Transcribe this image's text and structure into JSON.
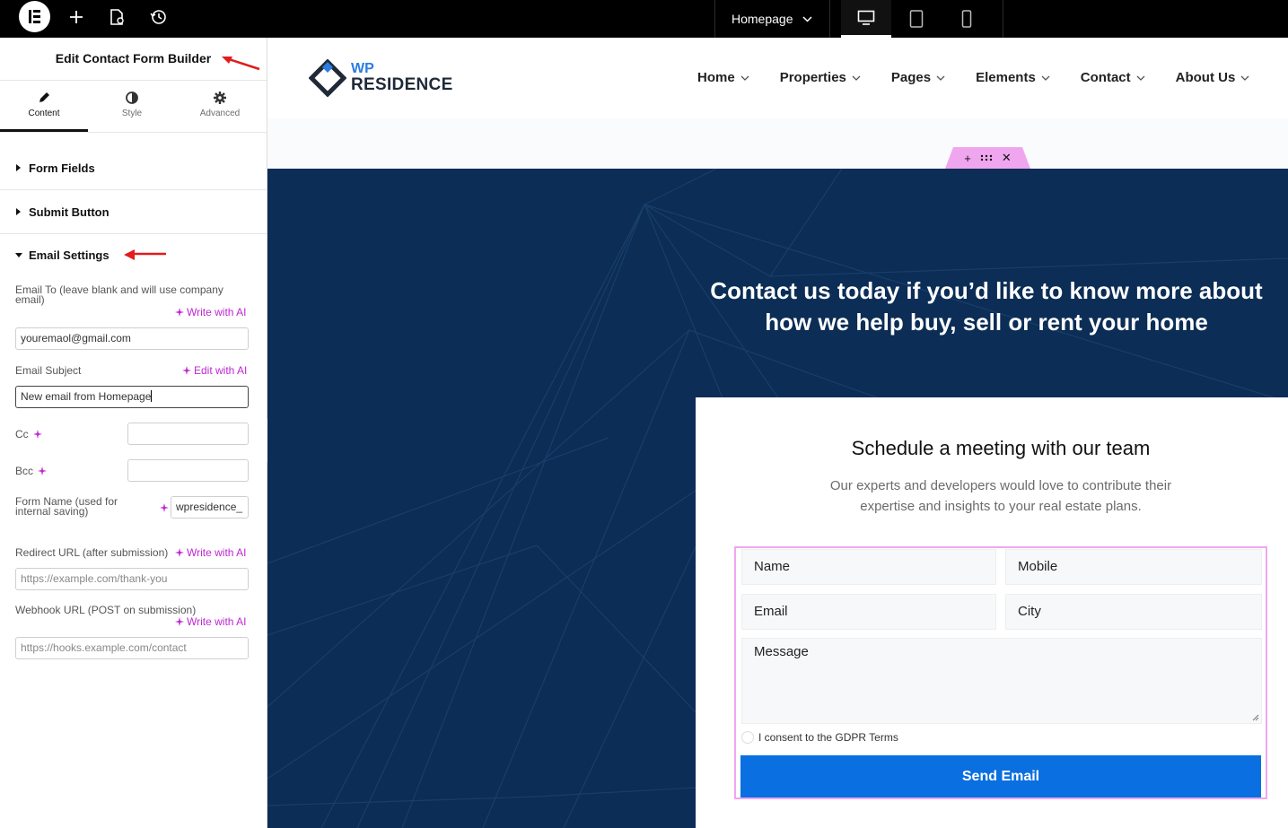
{
  "topbar": {
    "page_selector": "Homepage",
    "icons": [
      "elementor-logo-icon",
      "plus-icon",
      "page-settings-icon",
      "history-icon",
      "chevron-down-icon",
      "desktop-icon",
      "tablet-icon",
      "mobile-icon"
    ],
    "active_device": "desktop"
  },
  "panel": {
    "title": "Edit Contact Form Builder",
    "tabs": [
      {
        "label": "Content",
        "icon": "pencil-icon",
        "active": true
      },
      {
        "label": "Style",
        "icon": "half-circle-icon",
        "active": false
      },
      {
        "label": "Advanced",
        "icon": "gear-icon",
        "active": false
      }
    ],
    "sections": {
      "form_fields": "Form Fields",
      "submit_button": "Submit Button",
      "email_settings": "Email Settings"
    },
    "email_to": {
      "label": "Email To (leave blank and will use company email)",
      "ai": "Write with AI",
      "value": "youremaol@gmail.com"
    },
    "email_subject": {
      "label": "Email Subject",
      "ai": "Edit with AI",
      "value": "New email from Homepage"
    },
    "cc": {
      "label": "Cc",
      "value": ""
    },
    "bcc": {
      "label": "Bcc",
      "value": ""
    },
    "form_name": {
      "label": "Form Name (used for internal saving)",
      "value": "wpresidence_"
    },
    "redirect_url": {
      "label": "Redirect URL (after submission)",
      "ai": "Write with AI",
      "placeholder": "https://example.com/thank-you"
    },
    "webhook_url": {
      "label": "Webhook URL (POST on submission)",
      "ai": "Write with AI",
      "placeholder": "https://hooks.example.com/contact"
    }
  },
  "site": {
    "logo_top": "WP",
    "logo_bottom": "RESIDENCE",
    "nav": [
      "Home",
      "Properties",
      "Pages",
      "Elements",
      "Contact",
      "About Us"
    ],
    "hero_title": "Contact us today if you’d like to know more about how we help buy, sell or rent your home",
    "card_title": "Schedule a meeting with our team",
    "card_subtitle": "Our experts and developers would love to contribute their expertise and insights to your real estate plans.",
    "form": {
      "name": "Name",
      "mobile": "Mobile",
      "email": "Email",
      "city": "City",
      "message": "Message",
      "consent": "I consent to the GDPR Terms",
      "submit": "Send Email"
    }
  },
  "colors": {
    "hero_bg": "#0b2d56",
    "accent_button": "#0a6fe0",
    "ai_link": "#c026d3",
    "edit_outline": "#f0a6ef",
    "annotation_arrow": "#e11d1d"
  }
}
